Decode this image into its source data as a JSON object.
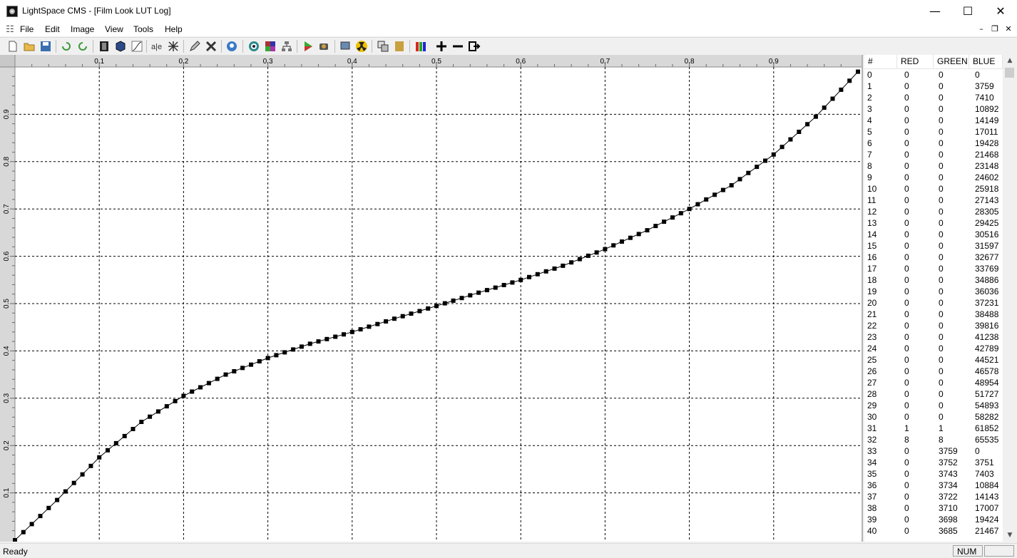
{
  "window": {
    "title": "LightSpace CMS - [Film Look LUT Log]"
  },
  "menu": {
    "file": "File",
    "edit": "Edit",
    "image": "Image",
    "view": "View",
    "tools": "Tools",
    "help": "Help"
  },
  "list": {
    "headers": {
      "index": "#",
      "red": "RED",
      "green": "GREEN",
      "blue": "BLUE"
    },
    "rows": [
      [
        "0",
        "0",
        "0",
        "0"
      ],
      [
        "1",
        "0",
        "0",
        "3759"
      ],
      [
        "2",
        "0",
        "0",
        "7410"
      ],
      [
        "3",
        "0",
        "0",
        "10892"
      ],
      [
        "4",
        "0",
        "0",
        "14149"
      ],
      [
        "5",
        "0",
        "0",
        "17011"
      ],
      [
        "6",
        "0",
        "0",
        "19428"
      ],
      [
        "7",
        "0",
        "0",
        "21468"
      ],
      [
        "8",
        "0",
        "0",
        "23148"
      ],
      [
        "9",
        "0",
        "0",
        "24602"
      ],
      [
        "10",
        "0",
        "0",
        "25918"
      ],
      [
        "11",
        "0",
        "0",
        "27143"
      ],
      [
        "12",
        "0",
        "0",
        "28305"
      ],
      [
        "13",
        "0",
        "0",
        "29425"
      ],
      [
        "14",
        "0",
        "0",
        "30516"
      ],
      [
        "15",
        "0",
        "0",
        "31597"
      ],
      [
        "16",
        "0",
        "0",
        "32677"
      ],
      [
        "17",
        "0",
        "0",
        "33769"
      ],
      [
        "18",
        "0",
        "0",
        "34886"
      ],
      [
        "19",
        "0",
        "0",
        "36036"
      ],
      [
        "20",
        "0",
        "0",
        "37231"
      ],
      [
        "21",
        "0",
        "0",
        "38488"
      ],
      [
        "22",
        "0",
        "0",
        "39816"
      ],
      [
        "23",
        "0",
        "0",
        "41238"
      ],
      [
        "24",
        "0",
        "0",
        "42789"
      ],
      [
        "25",
        "0",
        "0",
        "44521"
      ],
      [
        "26",
        "0",
        "0",
        "46578"
      ],
      [
        "27",
        "0",
        "0",
        "48954"
      ],
      [
        "28",
        "0",
        "0",
        "51727"
      ],
      [
        "29",
        "0",
        "0",
        "54893"
      ],
      [
        "30",
        "0",
        "0",
        "58282"
      ],
      [
        "31",
        "1",
        "1",
        "61852"
      ],
      [
        "32",
        "8",
        "8",
        "65535"
      ],
      [
        "33",
        "0",
        "3759",
        "0"
      ],
      [
        "34",
        "0",
        "3752",
        "3751"
      ],
      [
        "35",
        "0",
        "3743",
        "7403"
      ],
      [
        "36",
        "0",
        "3734",
        "10884"
      ],
      [
        "37",
        "0",
        "3722",
        "14143"
      ],
      [
        "38",
        "0",
        "3710",
        "17007"
      ],
      [
        "39",
        "0",
        "3698",
        "19424"
      ],
      [
        "40",
        "0",
        "3685",
        "21467"
      ]
    ]
  },
  "status": {
    "text": "Ready",
    "num": "NUM"
  },
  "chart_data": {
    "type": "scatter",
    "title": "",
    "xlabel": "",
    "ylabel": "",
    "xlim": [
      0,
      1
    ],
    "ylim": [
      0,
      1
    ],
    "x_ticks": [
      "0.1",
      "0.2",
      "0.3",
      "0.4",
      "0.5",
      "0.6",
      "0.7",
      "0.8",
      "0.9"
    ],
    "y_ticks": [
      "0.1",
      "0.2",
      "0.3",
      "0.4",
      "0.5",
      "0.6",
      "0.7",
      "0.8",
      "0.9"
    ],
    "grid": true,
    "points_count": 101,
    "anchors": {
      "x": [
        0,
        0.05,
        0.1,
        0.15,
        0.2,
        0.25,
        0.3,
        0.35,
        0.4,
        0.45,
        0.5,
        0.55,
        0.6,
        0.65,
        0.7,
        0.75,
        0.8,
        0.85,
        0.9,
        0.95,
        1.0
      ],
      "y": [
        0,
        0.085,
        0.175,
        0.25,
        0.305,
        0.35,
        0.385,
        0.415,
        0.44,
        0.468,
        0.495,
        0.523,
        0.55,
        0.58,
        0.615,
        0.655,
        0.7,
        0.75,
        0.815,
        0.895,
        0.99
      ]
    }
  }
}
